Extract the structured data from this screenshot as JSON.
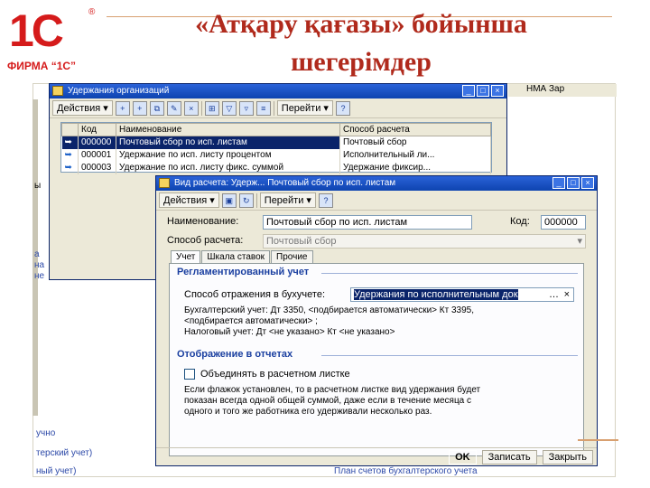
{
  "logo": {
    "mark": "1С",
    "registered": "®",
    "firm": "ФИРМА “1С”"
  },
  "slide": {
    "title_line1": "«Атқару қағазы» бойынша",
    "title_line2": "шегерімдер"
  },
  "background": {
    "right_bar": "НМА   Зар",
    "left_fragments": [
      "ы",
      "а",
      "на",
      "не"
    ],
    "bottom_fragments": [
      "учно",
      "терский учет)",
      "ный учет)"
    ],
    "bottom_link": "План счетов бухгалтерского учета"
  },
  "list_window": {
    "title": "Удержания организаций",
    "toolbar": {
      "actions": "Действия",
      "goto": "Перейти",
      "help": "?"
    },
    "columns": [
      "Код",
      "Наименование",
      "Способ расчета"
    ],
    "rows": [
      {
        "code": "000000",
        "name": "Почтовый сбор по исп. листам",
        "method": "Почтовый сбор"
      },
      {
        "code": "000001",
        "name": "Удержание по исп. листу процентом",
        "method": "Исполнительный ли..."
      },
      {
        "code": "000003",
        "name": "Удержание по исп. листу фикс. суммой",
        "method": "Удержание фиксир..."
      }
    ],
    "controls": [
      "_",
      "□",
      "×"
    ]
  },
  "form_window": {
    "title": "Вид расчета: Удерж... Почтовый сбор по исп. листам",
    "toolbar": {
      "actions": "Действия",
      "goto": "Перейти",
      "help": "?"
    },
    "name_label": "Наименование:",
    "name_value": "Почтовый сбор по исп. листам",
    "code_label": "Код:",
    "code_value": "000000",
    "method_label": "Способ расчета:",
    "method_value": "Почтовый сбор",
    "tabs": [
      "Учет",
      "Шкала ставок",
      "Прочие"
    ],
    "section1_title": "Регламентированный учет",
    "reflect_label": "Способ отражения в бухучете:",
    "reflect_value": "Удержания по исполнительным док",
    "acc_line1": "Бухгалтерский учет: Дт 3350, <подбирается автоматически> Кт 3395,",
    "acc_line2": "<подбирается автоматически> ;",
    "acc_line3": "Налоговый учет:  Дт <не указано> Кт <не указано>",
    "section2_title": "Отображение в отчетах",
    "checkbox_label": "Объединять в расчетном листке",
    "note_line1": "Если флажок установлен, то в расчетном листке вид удержания будет",
    "note_line2": "показан всегда одной общей суммой, даже если в течение месяца с",
    "note_line3": "одного и того же работника его удерживали несколько раз.",
    "buttons": {
      "ok": "OK",
      "save": "Записать",
      "close": "Закрыть"
    },
    "controls": [
      "_",
      "□",
      "×"
    ]
  }
}
